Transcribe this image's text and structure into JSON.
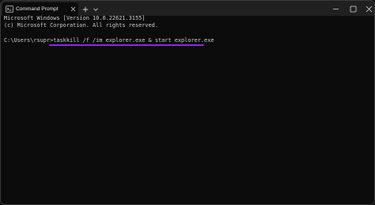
{
  "window": {
    "tab_title": "Command Prompt",
    "icons": {
      "tab": "terminal-icon",
      "close_tab": "close-icon",
      "new_tab": "plus-icon",
      "dropdown": "chevron-down-icon",
      "minimize": "minimize-icon",
      "maximize": "maximize-icon",
      "close_window": "close-icon"
    }
  },
  "console": {
    "lines": [
      "Microsoft Windows [Version 10.0.22621.3155]",
      "(c) Microsoft Corporation. All rights reserved.",
      "",
      "C:\\Users\\rsupr>taskkill /f /im explorer.exe & start explorer.exe"
    ]
  },
  "colors": {
    "background": "#0c0c0c",
    "titlebar": "#202020",
    "text": "#cccccc",
    "highlight_underline": "#8a2be2"
  }
}
